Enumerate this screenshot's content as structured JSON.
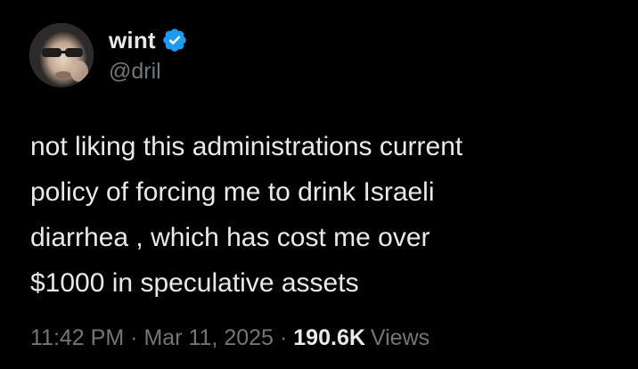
{
  "author": {
    "display_name": "wint",
    "handle": "@dril",
    "verified": true,
    "verified_color": "#1d9bf0",
    "avatar_icon": "profile-photo"
  },
  "tweet": {
    "lines": [
      "not liking this administrations current",
      "policy of forcing me to drink Israeli",
      "diarrhea , which has cost me over",
      "$1000 in speculative assets"
    ]
  },
  "meta": {
    "time": "11:42 PM",
    "separator": "·",
    "date": "Mar 11, 2025",
    "views_count": "190.6K",
    "views_label": "Views"
  },
  "colors": {
    "background": "#000000",
    "primary_text": "#e7e9ea",
    "secondary_text": "#71767b"
  }
}
